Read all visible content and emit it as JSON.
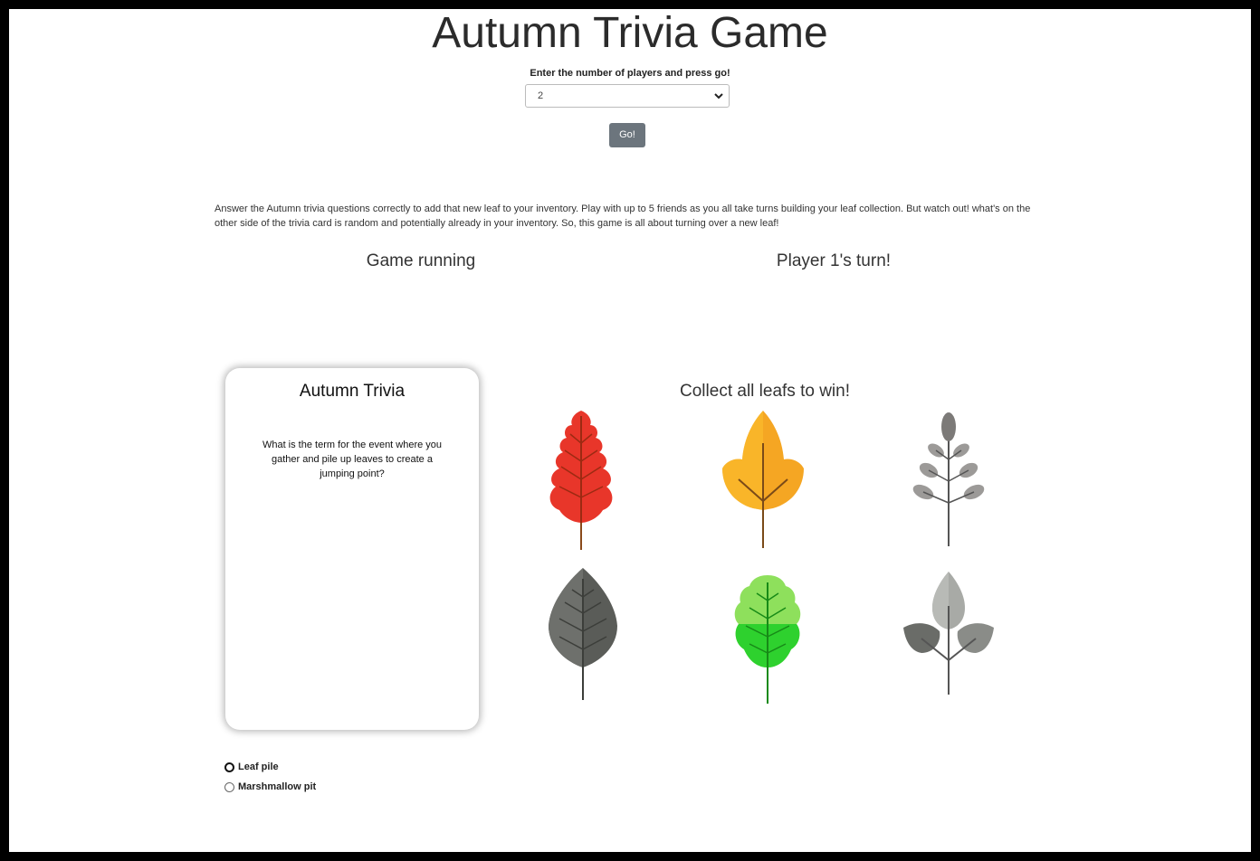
{
  "header": {
    "title": "Autumn Trivia Game",
    "prompt": "Enter the number of players and press go!"
  },
  "players_select": {
    "selected": "2"
  },
  "go_button": {
    "label": "Go!"
  },
  "description": "Answer the Autumn trivia questions correctly to add that new leaf to your inventory. Play with up to 5 friends as you all take turns building your leaf collection. But watch out! what's on the other side of the trivia card is random and potentially already in your inventory. So, this game is all about turning over a new leaf!",
  "status": {
    "game": "Game running",
    "turn": "Player 1's turn!"
  },
  "card": {
    "title": "Autumn Trivia",
    "question": "What is the term for the event where you gather and pile up leaves to create a jumping point?"
  },
  "collection": {
    "heading": "Collect all leafs to win!",
    "leaves": [
      {
        "icon": "red-maple-leaf-icon",
        "color": "#e8362a",
        "collected": true
      },
      {
        "icon": "orange-leaf-icon",
        "color": "#f5a623",
        "collected": true
      },
      {
        "icon": "gray-sprig-leaf-icon",
        "color": "#9e9e9e",
        "collected": false
      },
      {
        "icon": "dark-gray-leaf-icon",
        "color": "#5a5c58",
        "collected": false
      },
      {
        "icon": "green-leaf-icon",
        "color": "#3bd43b",
        "collected": true
      },
      {
        "icon": "gray-three-leaf-icon",
        "color": "#8a8a8a",
        "collected": false
      }
    ]
  },
  "answers": [
    {
      "label": "Leaf pile"
    },
    {
      "label": "Marshmallow pit"
    }
  ]
}
